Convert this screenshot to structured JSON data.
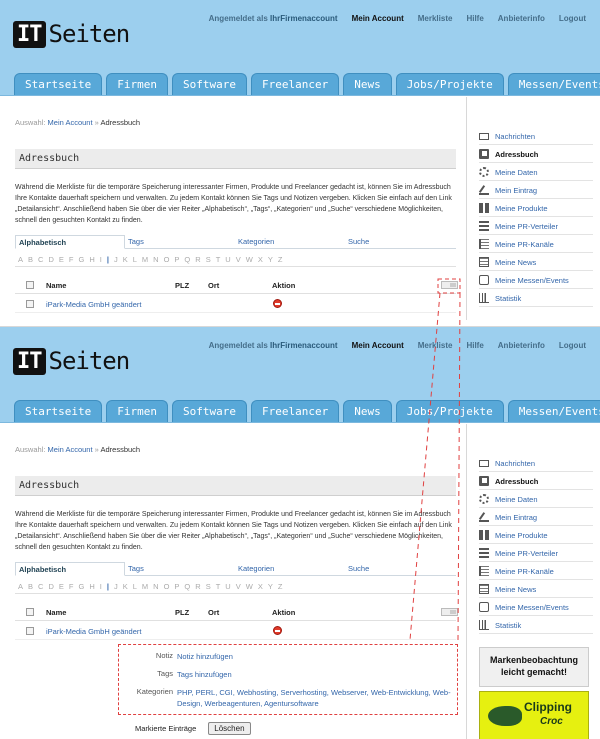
{
  "brand": {
    "it": "IT",
    "seiten": "Seiten"
  },
  "topnav": {
    "logged_in_label": "Angemeldet als",
    "username": "IhrFirmenaccount",
    "my_account": "Mein Account",
    "merkliste": "Merkliste",
    "hilfe": "Hilfe",
    "anbieterinfo": "Anbieterinfo",
    "logout": "Logout"
  },
  "tabs": [
    "Startseite",
    "Firmen",
    "Software",
    "Freelancer",
    "News",
    "Jobs/Projekte",
    "Messen/Events"
  ],
  "breadcrumb": {
    "prefix": "Auswahl:",
    "link": "Mein Account",
    "sep": "»",
    "current": "Adressbuch"
  },
  "page_title": "Adressbuch",
  "description": "Während die Merkliste für die temporäre Speicherung interessanter Firmen, Produkte und Freelancer gedacht ist, können Sie im Adressbuch Ihre Kontakte dauerhaft speichern und verwalten. Zu jedem Kontakt können Sie Tags und Notizen vergeben. Klicken Sie einfach auf den Link „Detailansicht“. Anschließend haben Sie über die vier Reiter „Alphabetisch“, „Tags“, „Kategorien“ und „Suche“ verschiedene Möglichkeiten, schnell den gesuchten Kontakt zu finden.",
  "filter_tabs": [
    "Alphabetisch",
    "Tags",
    "Kategorien",
    "Suche"
  ],
  "alphabet": [
    "A",
    "B",
    "C",
    "D",
    "E",
    "F",
    "G",
    "H",
    "I",
    "J",
    "K",
    "L",
    "M",
    "N",
    "O",
    "P",
    "Q",
    "R",
    "S",
    "T",
    "U",
    "V",
    "W",
    "X",
    "Y",
    "Z"
  ],
  "table": {
    "headers": {
      "name": "Name",
      "plz": "PLZ",
      "ort": "Ort",
      "aktion": "Aktion"
    },
    "rows": [
      {
        "name": "iPark-Media GmbH geändert",
        "plz": "",
        "ort": ""
      }
    ]
  },
  "details": {
    "notiz_label": "Notiz",
    "notiz_value": "Notiz hinzufügen",
    "tags_label": "Tags",
    "tags_value": "Tags hinzufügen",
    "kategorien_label": "Kategorien",
    "kategorien_value": "PHP, PERL, CGI, Webhosting, Serverhosting, Webserver, Web-Entwicklung, Web-Design, Werbeagenturen, Agentursoftware"
  },
  "footer": {
    "marked_label": "Markierte Einträge",
    "delete_button": "Löschen"
  },
  "sidebar": {
    "items": [
      {
        "label": "Nachrichten",
        "icon": "mail-icon"
      },
      {
        "label": "Adressbuch",
        "icon": "addressbook-icon",
        "active": true
      },
      {
        "label": "Meine Daten",
        "icon": "gear-icon"
      },
      {
        "label": "Mein Eintrag",
        "icon": "pen-icon"
      },
      {
        "label": "Meine Produkte",
        "icon": "grid-icon"
      },
      {
        "label": "Meine PR-Verteiler",
        "icon": "list-icon"
      },
      {
        "label": "Meine PR-Kanäle",
        "icon": "list2-icon"
      },
      {
        "label": "Meine News",
        "icon": "news-icon"
      },
      {
        "label": "Meine Messen/Events",
        "icon": "message-icon"
      },
      {
        "label": "Statistik",
        "icon": "chart-icon"
      }
    ]
  },
  "ad": {
    "line1": "Markenbeobachtung",
    "line2": "leicht gemacht!",
    "brand1": "Clipping",
    "brand2": "Croc"
  },
  "colors": {
    "header_bg": "#9ccfee",
    "tab_bg": "#58a8d8",
    "link": "#3366aa",
    "delete_red": "#e03a2a",
    "highlight_dash": "#e04040"
  }
}
